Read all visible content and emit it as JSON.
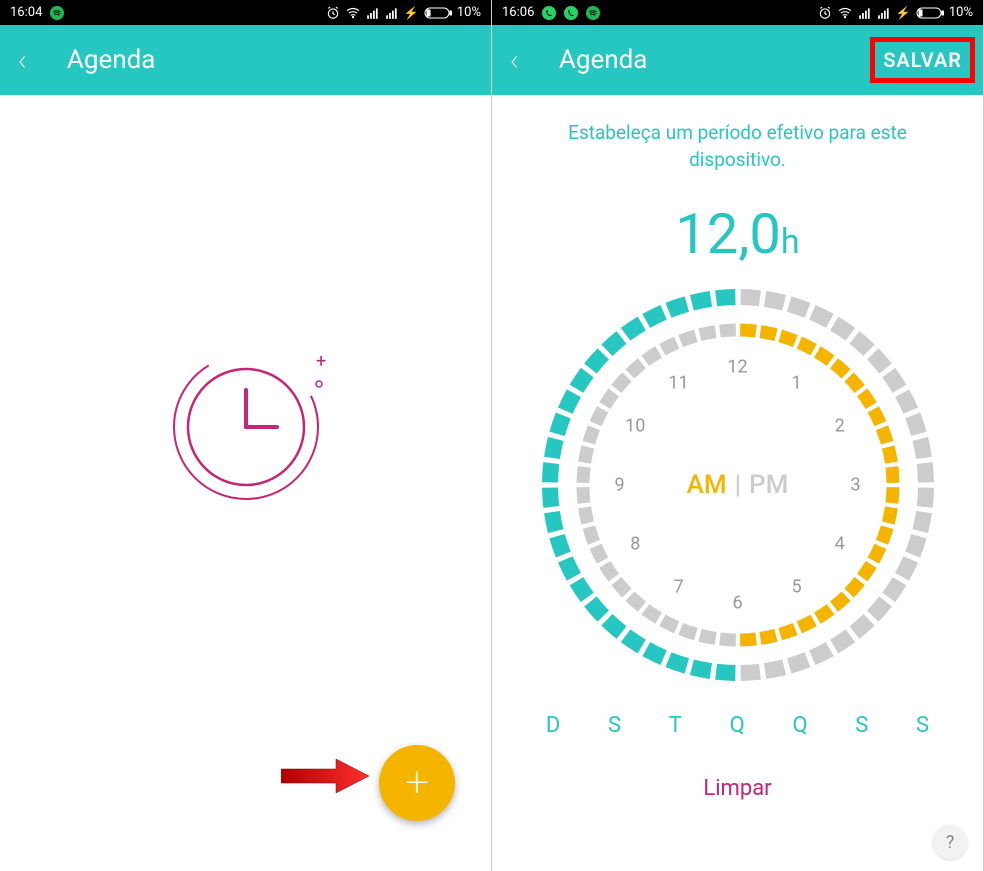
{
  "colors": {
    "teal": "#26c6c1",
    "magenta": "#c72476",
    "yellow": "#f5b400",
    "gray": "#ccc",
    "red": "#f00"
  },
  "left": {
    "statusbar": {
      "time": "16:04",
      "battery": "10%"
    },
    "header": {
      "title": "Agenda"
    }
  },
  "right": {
    "statusbar": {
      "time": "16:06",
      "battery": "10%"
    },
    "header": {
      "title": "Agenda",
      "save": "SALVAR"
    },
    "instruction": "Estabeleça um período efetivo para este dispositivo.",
    "time_value": "12,0",
    "time_unit": "h",
    "am_label": "AM",
    "pm_label": "PM",
    "hours": [
      "12",
      "1",
      "2",
      "3",
      "4",
      "5",
      "6",
      "7",
      "8",
      "9",
      "10",
      "11"
    ],
    "days": [
      "D",
      "S",
      "T",
      "Q",
      "Q",
      "S",
      "S"
    ],
    "clear": "Limpar"
  }
}
